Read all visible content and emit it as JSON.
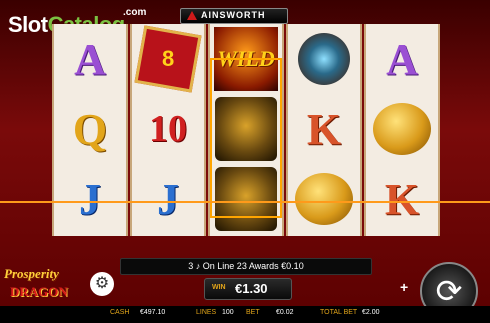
{
  "watermark": {
    "part1": "Slot",
    "part2": "Catalog",
    "suffix": ".com"
  },
  "provider": {
    "name": "AINSWORTH"
  },
  "reels": [
    {
      "symbols": [
        "A",
        "8",
        "Q"
      ]
    },
    {
      "symbols": [
        "10",
        "J"
      ]
    },
    {
      "symbols": [
        "WILD"
      ]
    },
    {
      "symbols": [
        "K",
        "K"
      ]
    },
    {
      "symbols": [
        "A",
        "K"
      ]
    }
  ],
  "message": "3 ♪ On Line 23 Awards €0.10",
  "win": {
    "label": "WIN",
    "value": "€1.30"
  },
  "status": {
    "cash_label": "CASH",
    "cash_value": "€497.10",
    "lines_label": "LINES",
    "lines_value": "100",
    "bet_label": "BET",
    "bet_value": "€0.02",
    "total_bet_label": "TOTAL BET",
    "total_bet_value": "€2.00"
  },
  "game_logo": {
    "line1": "Prosperity",
    "line2": "DRAGON"
  },
  "icons": {
    "settings": "gear-icon",
    "spin": "spin-arrows-icon",
    "plus": "plus-icon"
  },
  "colors": {
    "accent": "#ffa500",
    "frame": "#7a0a0a",
    "win_label": "#e2a51a"
  }
}
